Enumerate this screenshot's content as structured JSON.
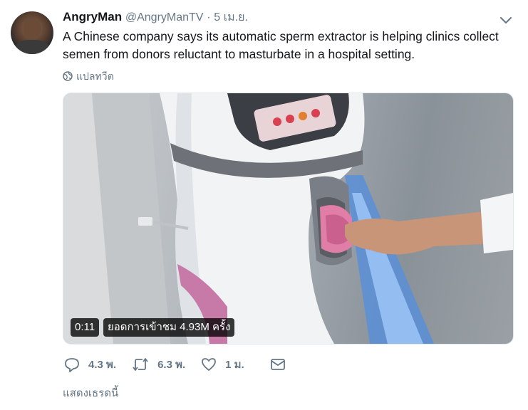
{
  "tweet": {
    "author_name": "AngryMan",
    "author_handle": "@AngryManTV",
    "separator": "·",
    "date": "5 เม.ย.",
    "text": "A Chinese company says its automatic sperm extractor is helping clinics collect semen from donors reluctant to masturbate in a hospital setting.",
    "translate_label": "แปลทวีต",
    "menu_icon": "chevron-down-icon"
  },
  "media": {
    "duration": "0:11",
    "views": "ยอดการเข้าชม 4.93M ครั้ง"
  },
  "actions": {
    "reply_count": "4.3 พ.",
    "retweet_count": "6.3 พ.",
    "like_count": "1 ม."
  },
  "footer": {
    "show_thread": "แสดงเธรดนี้"
  },
  "colors": {
    "text_primary": "#14171a",
    "text_secondary": "#657786",
    "badge_bg": "#000000"
  }
}
